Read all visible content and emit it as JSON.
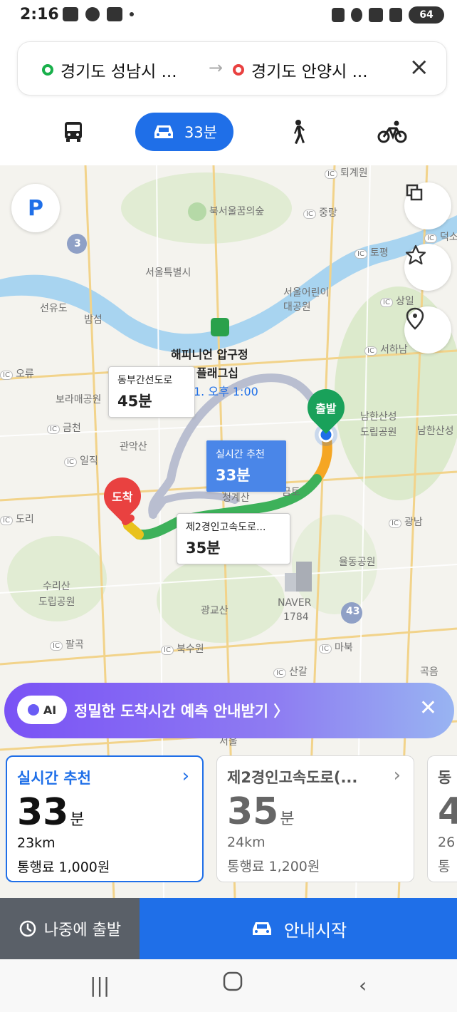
{
  "status": {
    "time": "2:16",
    "battery": "64"
  },
  "route": {
    "origin": "경기도 성남시 ...",
    "destination": "경기도 안양시 ...",
    "arrow": "→"
  },
  "modes": {
    "car_time": "33분"
  },
  "map": {
    "labels": [
      "북서울꿈의숲",
      "서울특별시",
      "서울어린이",
      "대공원",
      "선유도",
      "밤섬",
      "해피니언 압구정",
      "플래그십",
      "오류",
      "보라매공원",
      "금천",
      "관악산",
      "일직",
      "도리",
      "수리산",
      "도립공원",
      "광교산",
      "NAVER",
      "1784",
      "북수원",
      "팔곡",
      "마북",
      "산갈",
      "남한산성",
      "도립공원",
      "남한산성",
      "율동공원",
      "광남",
      "서하남",
      "상일",
      "토평",
      "중랑",
      "퇴계원",
      "덕소삼",
      "43",
      "3",
      "곡음",
      "서울",
      "청계산",
      "금토"
    ],
    "callouts": {
      "alt1_name": "동부간선도로",
      "alt1_time": "45분",
      "best_name": "실시간 추천",
      "best_time": "33분",
      "alt2_name": "제2경인고속도로...",
      "alt2_time": "35분",
      "timestamp": "1. 오후 1:00"
    },
    "start_label": "출발",
    "end_label": "도착",
    "parking_label": "P"
  },
  "ai_banner": {
    "badge": "AI",
    "text": "정밀한 도착시간 예측 안내받기 〉"
  },
  "cards": [
    {
      "title": "실시간 추천",
      "minutes": "33",
      "unit": "분",
      "distance": "23km",
      "toll": "통행료 1,000원"
    },
    {
      "title": "제2경인고속도로(...",
      "minutes": "35",
      "unit": "분",
      "distance": "24km",
      "toll": "통행료 1,200원"
    },
    {
      "title": "동",
      "minutes": "4",
      "unit": "",
      "distance": "26",
      "toll": "통"
    }
  ],
  "actions": {
    "later": "나중에 출발",
    "start": "안내시작"
  },
  "colors": {
    "accent": "#1f6fe8",
    "route_green": "#3db15a",
    "route_orange": "#f5a623",
    "start_pin": "#19a15a",
    "end_pin": "#e94140"
  }
}
